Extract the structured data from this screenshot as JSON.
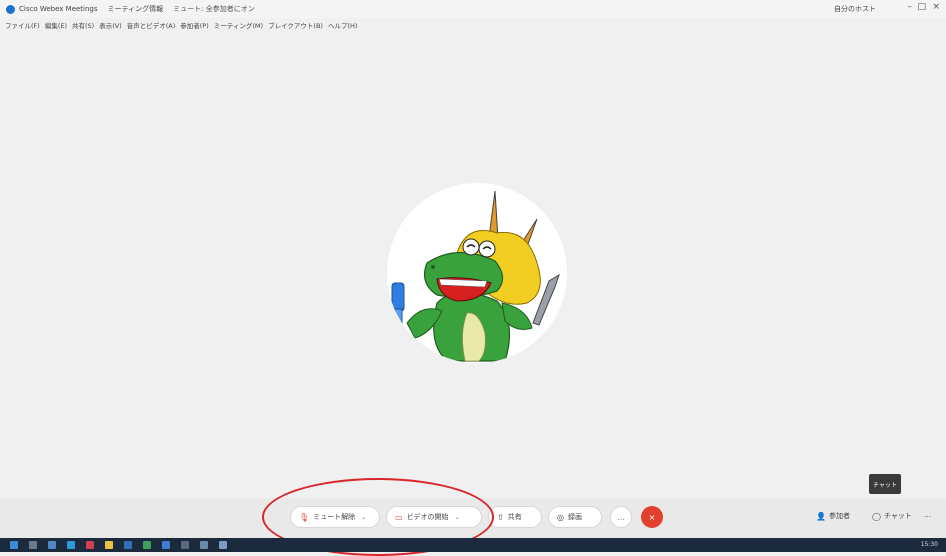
{
  "titlebar": {
    "app_name": "Cisco Webex Meetings",
    "meeting_info": "ミーティング情報",
    "status_text": "ミュート: 全参加者にオン",
    "user": "自分のホスト",
    "minimize": "–",
    "maximize": "□",
    "close": "×"
  },
  "menubar": {
    "items": [
      "ファイル(F)",
      "編集(E)",
      "共有(S)",
      "表示(V)",
      "音声とビデオ(A)",
      "参加者(P)",
      "ミーティング(M)",
      "ブレイクアウト(B)",
      "ヘルプ(H)"
    ]
  },
  "tooltip": {
    "text": "チャット"
  },
  "controls": {
    "mute_label": "ミュート解除",
    "video_label": "ビデオの開始",
    "share_label": "共有",
    "record_label": "録画",
    "more_label": "…",
    "leave_label": "×",
    "participants_label": "参加者",
    "chat_label": "チャット",
    "overflow_label": "…"
  },
  "taskbar": {
    "clock": "15:30"
  },
  "colors": {
    "leave": "#e0402c",
    "annotation": "#d8262b",
    "taskbar": "#1b2a3d",
    "accent": "#1a73c9"
  }
}
